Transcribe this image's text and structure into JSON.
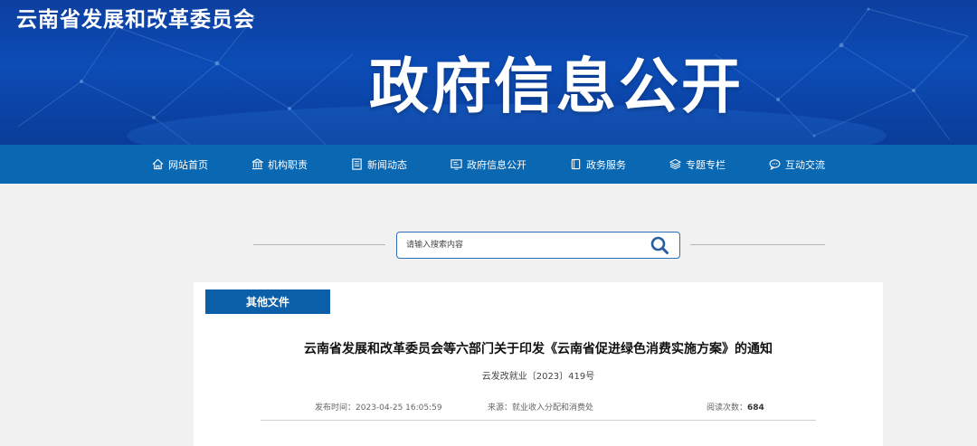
{
  "header": {
    "site_title": "云南省发展和改革委员会",
    "section_title": "政府信息公开"
  },
  "nav": [
    {
      "label": "网站首页",
      "icon": "home-icon"
    },
    {
      "label": "机构职责",
      "icon": "institution-icon"
    },
    {
      "label": "新闻动态",
      "icon": "news-icon"
    },
    {
      "label": "政府信息公开",
      "icon": "info-disclosure-icon"
    },
    {
      "label": "政务服务",
      "icon": "service-icon"
    },
    {
      "label": "专题专栏",
      "icon": "layers-icon"
    },
    {
      "label": "互动交流",
      "icon": "chat-icon"
    }
  ],
  "search": {
    "placeholder": "请输入搜索内容",
    "icon": "search-icon"
  },
  "article": {
    "category_tab": "其他文件",
    "title": "云南省发展和改革委员会等六部门关于印发《云南省促进绿色消费实施方案》的通知",
    "doc_number": "云发改就业〔2023〕419号",
    "publish_label": "发布时间：",
    "publish_time": "2023-04-25 16:05:59",
    "source_label": "来源：",
    "source": "就业收入分配和消费处",
    "views_label": "阅读次数：",
    "views": "684"
  },
  "colors": {
    "banner": "#0c4cb6",
    "nav": "#0a67b2",
    "tab": "#0b5ea8",
    "search_border": "#2c6fba"
  }
}
